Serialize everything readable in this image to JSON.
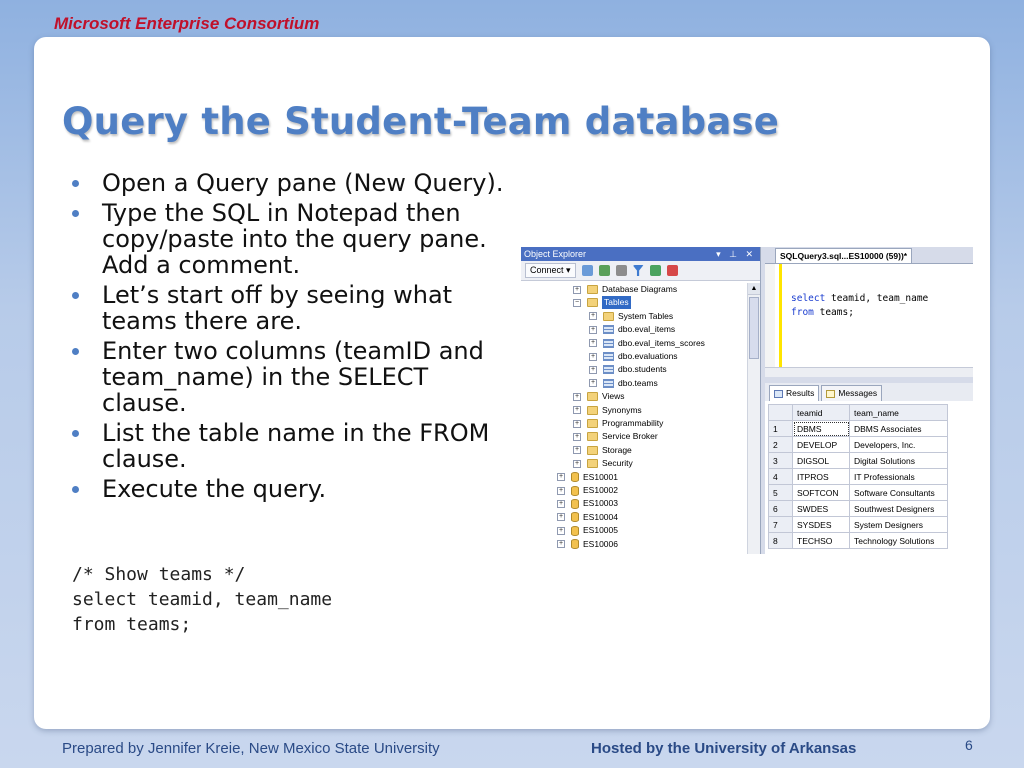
{
  "header": {
    "org": "Microsoft Enterprise Consortium"
  },
  "slide": {
    "title": "Query the Student-Team database",
    "bullets": [
      "Open a Query pane (New Query).",
      "Type the SQL in Notepad then copy/paste into the query pane.  Add a comment.",
      "Let’s start off by seeing what teams there are.",
      "Enter two columns (teamID and team_name) in the SELECT clause.",
      "List the table name in the FROM clause.",
      "Execute the query."
    ],
    "code": "/* Show teams */\nselect teamid, team_name\nfrom teams;"
  },
  "object_explorer": {
    "title": "Object Explorer",
    "title_controls": "▾ ⊥ ✕",
    "connect_label": "Connect ▾",
    "tree": [
      {
        "label": "Database Diagrams",
        "icon": "folder-icon",
        "expander": "+"
      },
      {
        "label": "Tables",
        "icon": "folder-icon",
        "expander": "−",
        "selected": true
      },
      {
        "label": "System Tables",
        "icon": "folder-icon",
        "expander": "+"
      },
      {
        "label": "dbo.eval_items",
        "icon": "table-icon",
        "expander": "+"
      },
      {
        "label": "dbo.eval_items_scores",
        "icon": "table-icon",
        "expander": "+"
      },
      {
        "label": "dbo.evaluations",
        "icon": "table-icon",
        "expander": "+"
      },
      {
        "label": "dbo.students",
        "icon": "table-icon",
        "expander": "+"
      },
      {
        "label": "dbo.teams",
        "icon": "table-icon",
        "expander": "+"
      },
      {
        "label": "Views",
        "icon": "folder-icon",
        "expander": "+"
      },
      {
        "label": "Synonyms",
        "icon": "folder-icon",
        "expander": "+"
      },
      {
        "label": "Programmability",
        "icon": "folder-icon",
        "expander": "+"
      },
      {
        "label": "Service Broker",
        "icon": "folder-icon",
        "expander": "+"
      },
      {
        "label": "Storage",
        "icon": "folder-icon",
        "expander": "+"
      },
      {
        "label": "Security",
        "icon": "folder-icon",
        "expander": "+"
      },
      {
        "label": "ES10001",
        "icon": "database-icon",
        "expander": "+"
      },
      {
        "label": "ES10002",
        "icon": "database-icon",
        "expander": "+"
      },
      {
        "label": "ES10003",
        "icon": "database-icon",
        "expander": "+"
      },
      {
        "label": "ES10004",
        "icon": "database-icon",
        "expander": "+"
      },
      {
        "label": "ES10005",
        "icon": "database-icon",
        "expander": "+"
      },
      {
        "label": "ES10006",
        "icon": "database-icon",
        "expander": "+"
      }
    ]
  },
  "query_pane": {
    "tab_label": "SQLQuery3.sql...ES10000 (59))*",
    "sql_line1_kw": "select",
    "sql_line1_rest": " teamid, team_name",
    "sql_line2_kw": "from",
    "sql_line2_rest": " teams;",
    "results_tab": "Results",
    "messages_tab": "Messages",
    "columns": [
      "teamid",
      "team_name"
    ],
    "rows": [
      [
        "1",
        "DBMS",
        "DBMS Associates"
      ],
      [
        "2",
        "DEVELOP",
        "Developers, Inc."
      ],
      [
        "3",
        "DIGSOL",
        "Digital Solutions"
      ],
      [
        "4",
        "ITPROS",
        "IT Professionals"
      ],
      [
        "5",
        "SOFTCON",
        "Software Consultants"
      ],
      [
        "6",
        "SWDES",
        "Southwest Designers"
      ],
      [
        "7",
        "SYSDES",
        "System Designers"
      ],
      [
        "8",
        "TECHSO",
        "Technology Solutions"
      ]
    ]
  },
  "footer": {
    "left": "Prepared by Jennifer Kreie, New Mexico State University",
    "right": "Hosted by the University of Arkansas",
    "page": "6"
  }
}
